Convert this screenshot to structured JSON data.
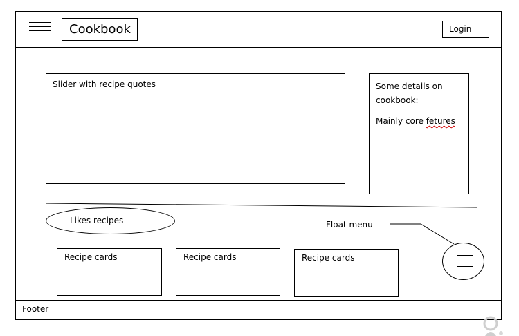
{
  "header": {
    "logo_text": "Cookbook",
    "login_label": "Login",
    "menu_icon": "hamburger-menu-icon"
  },
  "main": {
    "slider_text": "Slider with recipe quotes",
    "details": {
      "line1": "Some details on cookbook:",
      "line2_prefix": "Mainly core ",
      "line2_misspelled": "fetures"
    },
    "likes_label": "Likes recipes",
    "float_menu_label": "Float menu",
    "float_menu_icon": "hamburger-menu-icon",
    "cards": [
      {
        "label": "Recipe cards"
      },
      {
        "label": "Recipe cards"
      },
      {
        "label": "Recipe cards"
      }
    ]
  },
  "footer": {
    "text": "Footer"
  },
  "colors": {
    "line": "#000000",
    "background": "#ffffff",
    "spellcheck": "#d00000"
  }
}
